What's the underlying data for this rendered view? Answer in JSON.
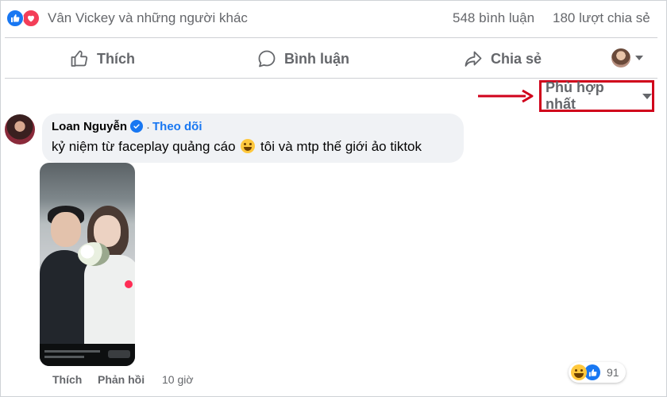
{
  "summary": {
    "reaction_icons": [
      "like-icon",
      "love-icon"
    ],
    "names": "Vân Vickey và những người khác",
    "comments": "548 bình luận",
    "shares": "180 lượt chia sẻ"
  },
  "actions": {
    "like": "Thích",
    "comment": "Bình luận",
    "share": "Chia sẻ"
  },
  "sort": {
    "label": "Phù hợp nhất"
  },
  "annotation_color": "#d0021b",
  "comment": {
    "author": "Loan Nguyễn",
    "follow": "Theo dõi",
    "text_before": "kỷ niệm từ faceplay quảng cáo",
    "emoji": "grinning-sweat-emoji",
    "text_after": "tôi và mtp thế giới ảo tiktok",
    "footer": {
      "like": "Thích",
      "reply": "Phản hồi",
      "time": "10 giờ"
    },
    "reactions": {
      "icons": [
        "haha-icon",
        "like-icon"
      ],
      "count": "91"
    }
  },
  "colors": {
    "accent": "#1877f2",
    "muted": "#65676b",
    "bubble": "#f0f2f5"
  }
}
